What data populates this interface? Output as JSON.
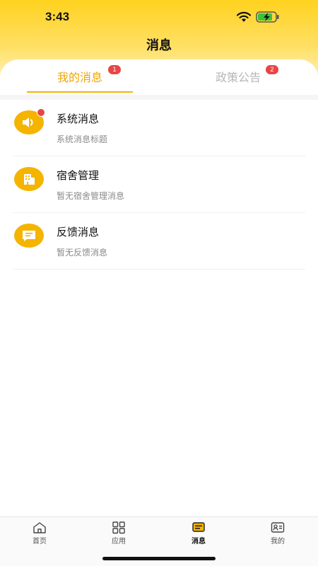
{
  "status": {
    "time": "3:43"
  },
  "header": {
    "title": "消息"
  },
  "tabs": [
    {
      "label": "我的消息",
      "badge": "1",
      "active": true
    },
    {
      "label": "政策公告",
      "badge": "2",
      "active": false
    }
  ],
  "messages": [
    {
      "title": "系统消息",
      "subtitle": "系统消息标题",
      "icon": "speaker-icon",
      "unread": true
    },
    {
      "title": "宿舍管理",
      "subtitle": "暂无宿舍管理消息",
      "icon": "building-icon",
      "unread": false
    },
    {
      "title": "反馈消息",
      "subtitle": "暂无反馈消息",
      "icon": "chat-icon",
      "unread": false
    }
  ],
  "bottom_nav": [
    {
      "label": "首页",
      "icon": "home-icon"
    },
    {
      "label": "应用",
      "icon": "grid-icon"
    },
    {
      "label": "消息",
      "icon": "message-icon",
      "active": true
    },
    {
      "label": "我的",
      "icon": "profile-card-icon"
    }
  ],
  "colors": {
    "accent": "#f4b400",
    "badge": "#e84545",
    "header": "#ffd21f"
  }
}
